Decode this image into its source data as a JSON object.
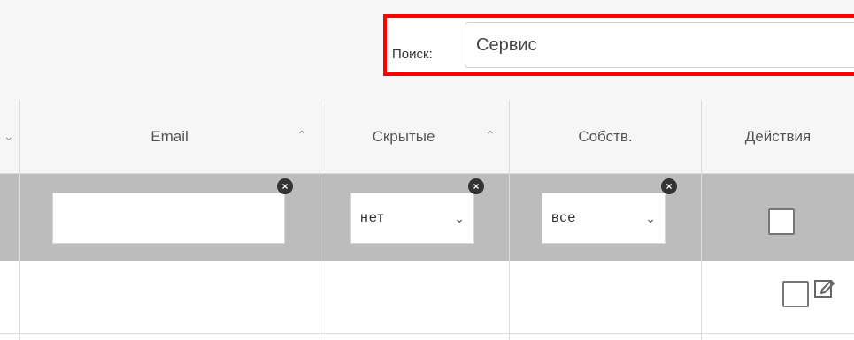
{
  "search": {
    "label": "Поиск:",
    "value": "Сервис"
  },
  "columns": {
    "email": "Email",
    "hidden": "Скрытые",
    "own": "Собств.",
    "actions": "Действия"
  },
  "filters": {
    "hidden_value": "нет",
    "own_value": "все"
  },
  "icons": {
    "sort": "sort-ascending",
    "clear": "clear-circle",
    "edit": "edit-icon",
    "checkbox": "checkbox"
  }
}
